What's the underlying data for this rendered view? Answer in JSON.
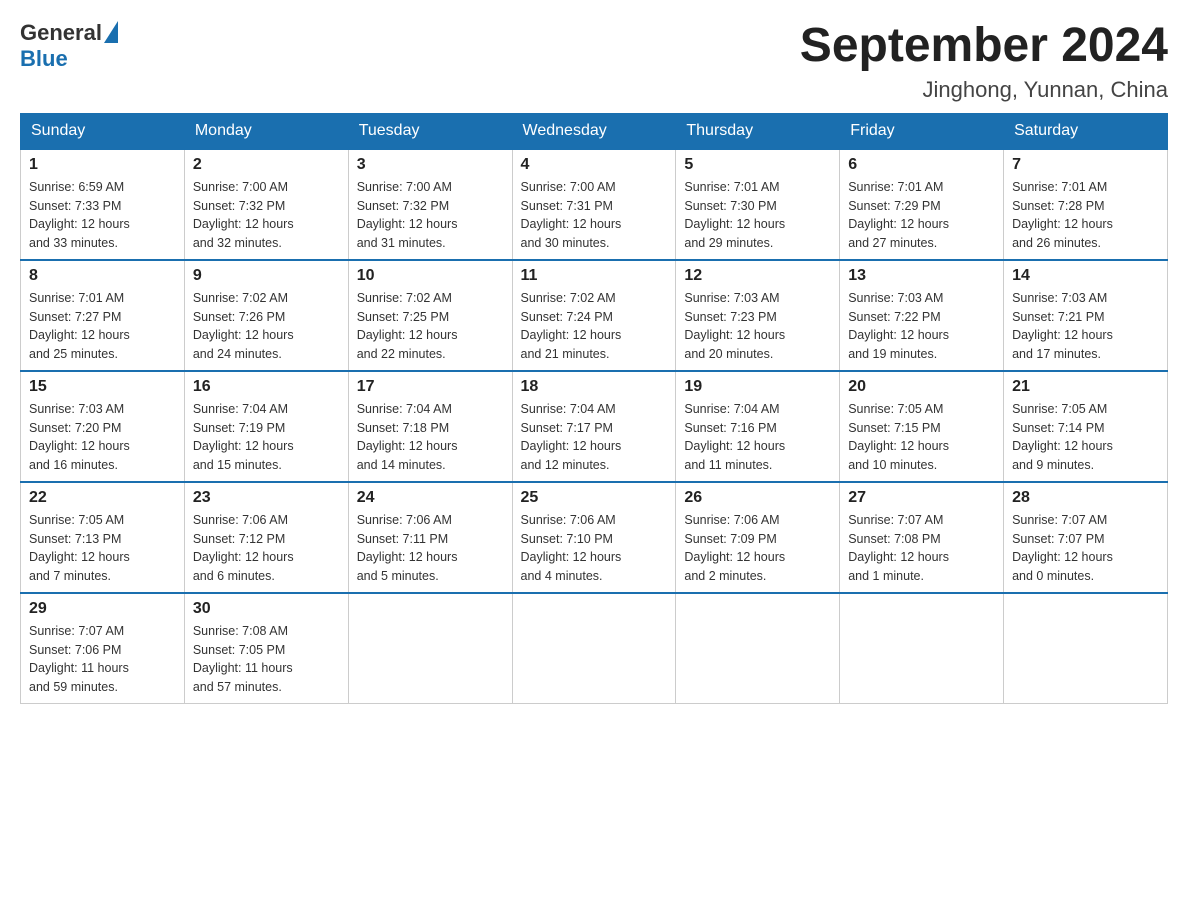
{
  "header": {
    "logo_general": "General",
    "logo_blue": "Blue",
    "title": "September 2024",
    "subtitle": "Jinghong, Yunnan, China"
  },
  "weekdays": [
    "Sunday",
    "Monday",
    "Tuesday",
    "Wednesday",
    "Thursday",
    "Friday",
    "Saturday"
  ],
  "weeks": [
    [
      {
        "day": "1",
        "sunrise": "6:59 AM",
        "sunset": "7:33 PM",
        "daylight": "12 hours and 33 minutes."
      },
      {
        "day": "2",
        "sunrise": "7:00 AM",
        "sunset": "7:32 PM",
        "daylight": "12 hours and 32 minutes."
      },
      {
        "day": "3",
        "sunrise": "7:00 AM",
        "sunset": "7:32 PM",
        "daylight": "12 hours and 31 minutes."
      },
      {
        "day": "4",
        "sunrise": "7:00 AM",
        "sunset": "7:31 PM",
        "daylight": "12 hours and 30 minutes."
      },
      {
        "day": "5",
        "sunrise": "7:01 AM",
        "sunset": "7:30 PM",
        "daylight": "12 hours and 29 minutes."
      },
      {
        "day": "6",
        "sunrise": "7:01 AM",
        "sunset": "7:29 PM",
        "daylight": "12 hours and 27 minutes."
      },
      {
        "day": "7",
        "sunrise": "7:01 AM",
        "sunset": "7:28 PM",
        "daylight": "12 hours and 26 minutes."
      }
    ],
    [
      {
        "day": "8",
        "sunrise": "7:01 AM",
        "sunset": "7:27 PM",
        "daylight": "12 hours and 25 minutes."
      },
      {
        "day": "9",
        "sunrise": "7:02 AM",
        "sunset": "7:26 PM",
        "daylight": "12 hours and 24 minutes."
      },
      {
        "day": "10",
        "sunrise": "7:02 AM",
        "sunset": "7:25 PM",
        "daylight": "12 hours and 22 minutes."
      },
      {
        "day": "11",
        "sunrise": "7:02 AM",
        "sunset": "7:24 PM",
        "daylight": "12 hours and 21 minutes."
      },
      {
        "day": "12",
        "sunrise": "7:03 AM",
        "sunset": "7:23 PM",
        "daylight": "12 hours and 20 minutes."
      },
      {
        "day": "13",
        "sunrise": "7:03 AM",
        "sunset": "7:22 PM",
        "daylight": "12 hours and 19 minutes."
      },
      {
        "day": "14",
        "sunrise": "7:03 AM",
        "sunset": "7:21 PM",
        "daylight": "12 hours and 17 minutes."
      }
    ],
    [
      {
        "day": "15",
        "sunrise": "7:03 AM",
        "sunset": "7:20 PM",
        "daylight": "12 hours and 16 minutes."
      },
      {
        "day": "16",
        "sunrise": "7:04 AM",
        "sunset": "7:19 PM",
        "daylight": "12 hours and 15 minutes."
      },
      {
        "day": "17",
        "sunrise": "7:04 AM",
        "sunset": "7:18 PM",
        "daylight": "12 hours and 14 minutes."
      },
      {
        "day": "18",
        "sunrise": "7:04 AM",
        "sunset": "7:17 PM",
        "daylight": "12 hours and 12 minutes."
      },
      {
        "day": "19",
        "sunrise": "7:04 AM",
        "sunset": "7:16 PM",
        "daylight": "12 hours and 11 minutes."
      },
      {
        "day": "20",
        "sunrise": "7:05 AM",
        "sunset": "7:15 PM",
        "daylight": "12 hours and 10 minutes."
      },
      {
        "day": "21",
        "sunrise": "7:05 AM",
        "sunset": "7:14 PM",
        "daylight": "12 hours and 9 minutes."
      }
    ],
    [
      {
        "day": "22",
        "sunrise": "7:05 AM",
        "sunset": "7:13 PM",
        "daylight": "12 hours and 7 minutes."
      },
      {
        "day": "23",
        "sunrise": "7:06 AM",
        "sunset": "7:12 PM",
        "daylight": "12 hours and 6 minutes."
      },
      {
        "day": "24",
        "sunrise": "7:06 AM",
        "sunset": "7:11 PM",
        "daylight": "12 hours and 5 minutes."
      },
      {
        "day": "25",
        "sunrise": "7:06 AM",
        "sunset": "7:10 PM",
        "daylight": "12 hours and 4 minutes."
      },
      {
        "day": "26",
        "sunrise": "7:06 AM",
        "sunset": "7:09 PM",
        "daylight": "12 hours and 2 minutes."
      },
      {
        "day": "27",
        "sunrise": "7:07 AM",
        "sunset": "7:08 PM",
        "daylight": "12 hours and 1 minute."
      },
      {
        "day": "28",
        "sunrise": "7:07 AM",
        "sunset": "7:07 PM",
        "daylight": "12 hours and 0 minutes."
      }
    ],
    [
      {
        "day": "29",
        "sunrise": "7:07 AM",
        "sunset": "7:06 PM",
        "daylight": "11 hours and 59 minutes."
      },
      {
        "day": "30",
        "sunrise": "7:08 AM",
        "sunset": "7:05 PM",
        "daylight": "11 hours and 57 minutes."
      },
      null,
      null,
      null,
      null,
      null
    ]
  ],
  "labels": {
    "sunrise": "Sunrise:",
    "sunset": "Sunset:",
    "daylight": "Daylight:"
  }
}
